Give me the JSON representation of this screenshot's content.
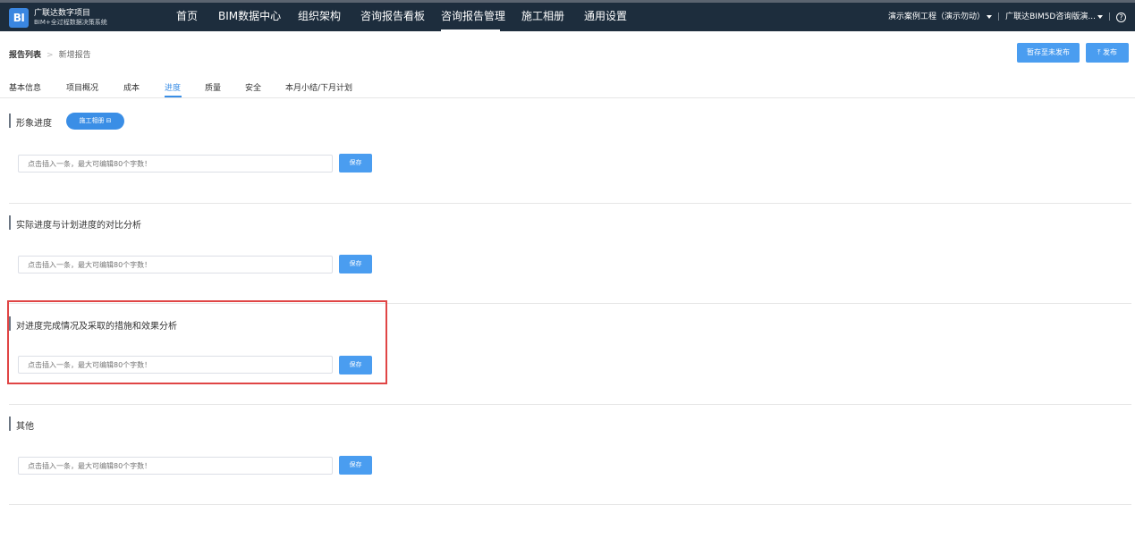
{
  "header": {
    "logo_badge": "BI",
    "logo_title": "广联达数字项目",
    "logo_subtitle": "BIM+全过程数据决策系统",
    "nav": [
      "首页",
      "BIM数据中心",
      "组织架构",
      "咨询报告看板",
      "咨询报告管理",
      "施工相册",
      "通用设置"
    ],
    "active_nav": "咨询报告管理",
    "project_selector": "演示案例工程（演示勿动）",
    "product_selector": "广联达BIM5D咨询版演...",
    "separator": "|",
    "help_label": "?"
  },
  "breadcrumb": {
    "current": "报告列表",
    "arrow": ">",
    "sub": "新增报告"
  },
  "actions": {
    "save_draft": "暂存至未发布",
    "publish": "⤒ 发布"
  },
  "tabs": [
    "基本信息",
    "项目概况",
    "成本",
    "进度",
    "质量",
    "安全",
    "本月小结/下月计划"
  ],
  "active_tab": "进度",
  "sections": [
    {
      "title": "形象进度",
      "pill": "施工相册 ⊟",
      "placeholder": "点击插入一条，最大可编辑80个字数！",
      "save": "保存"
    },
    {
      "title": "实际进度与计划进度的对比分析",
      "placeholder": "点击插入一条，最大可编辑80个字数！",
      "save": "保存"
    },
    {
      "title": "对进度完成情况及采取的措施和效果分析",
      "placeholder": "点击插入一条，最大可编辑80个字数！",
      "save": "保存",
      "highlighted": true
    },
    {
      "title": "其他",
      "placeholder": "点击插入一条，最大可编辑80个字数！",
      "save": "保存"
    }
  ],
  "colors": {
    "topbar": "#1d2d3d",
    "accent": "#3a8ee6",
    "button": "#4a9df0",
    "highlight": "#e04545"
  }
}
